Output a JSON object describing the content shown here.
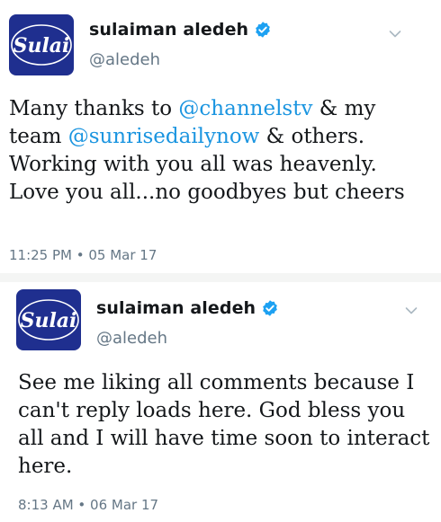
{
  "colors": {
    "mention": "#1b95e0",
    "verified": "#1da1f2",
    "text": "#14171a",
    "secondary": "#657786",
    "avatar_bg": "#1f2f8f"
  },
  "tweets": [
    {
      "avatar": {
        "text": "Sulai"
      },
      "display_name": "sulaiman aledeh",
      "verified_icon": "verified-badge-icon",
      "handle": "@aledeh",
      "more_icon": "chevron-down-icon",
      "text_parts": [
        "Many thanks to ",
        "@channelstv",
        " & my team ",
        "@sunrisedailynow",
        " & others. Working with you all was heavenly. Love you all...no goodbyes but cheers"
      ],
      "timestamp": "11:25 PM • 05 Mar 17"
    },
    {
      "avatar": {
        "text": "Sulai"
      },
      "display_name": "sulaiman aledeh",
      "verified_icon": "verified-badge-icon",
      "handle": "@aledeh",
      "more_icon": "chevron-down-icon",
      "text": "See me liking all comments because I can't reply loads here. God bless you all and I will have time soon to interact here.",
      "timestamp": "8:13 AM • 06 Mar 17"
    }
  ]
}
